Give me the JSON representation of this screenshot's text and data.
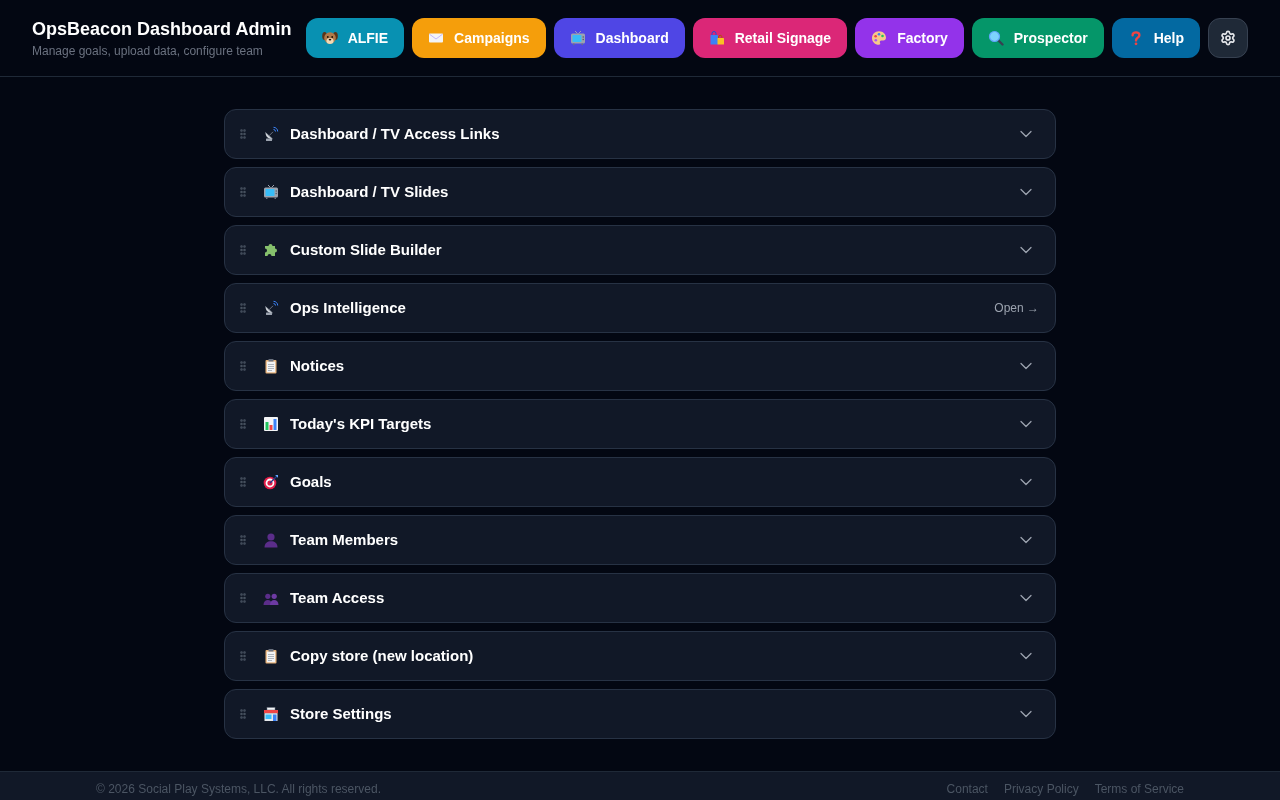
{
  "header": {
    "title": "OpsBeacon Dashboard Admin",
    "subtitle": "Manage goals, upload data, configure team"
  },
  "nav": [
    {
      "label": "ALFIE",
      "color": "#0891b2"
    },
    {
      "label": "Campaigns",
      "color": "#f59e0b"
    },
    {
      "label": "Dashboard",
      "color": "#4f46e5"
    },
    {
      "label": "Retail Signage",
      "color": "#db2777"
    },
    {
      "label": "Factory",
      "color": "#9333ea"
    },
    {
      "label": "Prospector",
      "color": "#059669"
    },
    {
      "label": "Help",
      "color": "#0369a1"
    }
  ],
  "sections": [
    {
      "title": "Dashboard / TV Access Links",
      "kind": "collapsible",
      "expanded": false
    },
    {
      "title": "Dashboard / TV Slides",
      "kind": "collapsible",
      "expanded": false
    },
    {
      "title": "Custom Slide Builder",
      "kind": "collapsible",
      "expanded": false
    },
    {
      "title": "Ops Intelligence",
      "kind": "link",
      "link_label": "Open →"
    },
    {
      "title": "Notices",
      "kind": "collapsible",
      "expanded": false
    },
    {
      "title": "Today's KPI Targets",
      "kind": "collapsible",
      "expanded": false
    },
    {
      "title": "Goals",
      "kind": "collapsible",
      "expanded": false
    },
    {
      "title": "Team Members",
      "kind": "collapsible",
      "expanded": false
    },
    {
      "title": "Team Access",
      "kind": "collapsible",
      "expanded": false
    },
    {
      "title": "Copy store (new location)",
      "kind": "collapsible",
      "expanded": false
    },
    {
      "title": "Store Settings",
      "kind": "collapsible",
      "expanded": false
    }
  ],
  "footer": {
    "copyright": "© 2026 Social Play Systems, LLC. All rights reserved.",
    "links": [
      "Contact",
      "Privacy Policy",
      "Terms of Service"
    ]
  }
}
